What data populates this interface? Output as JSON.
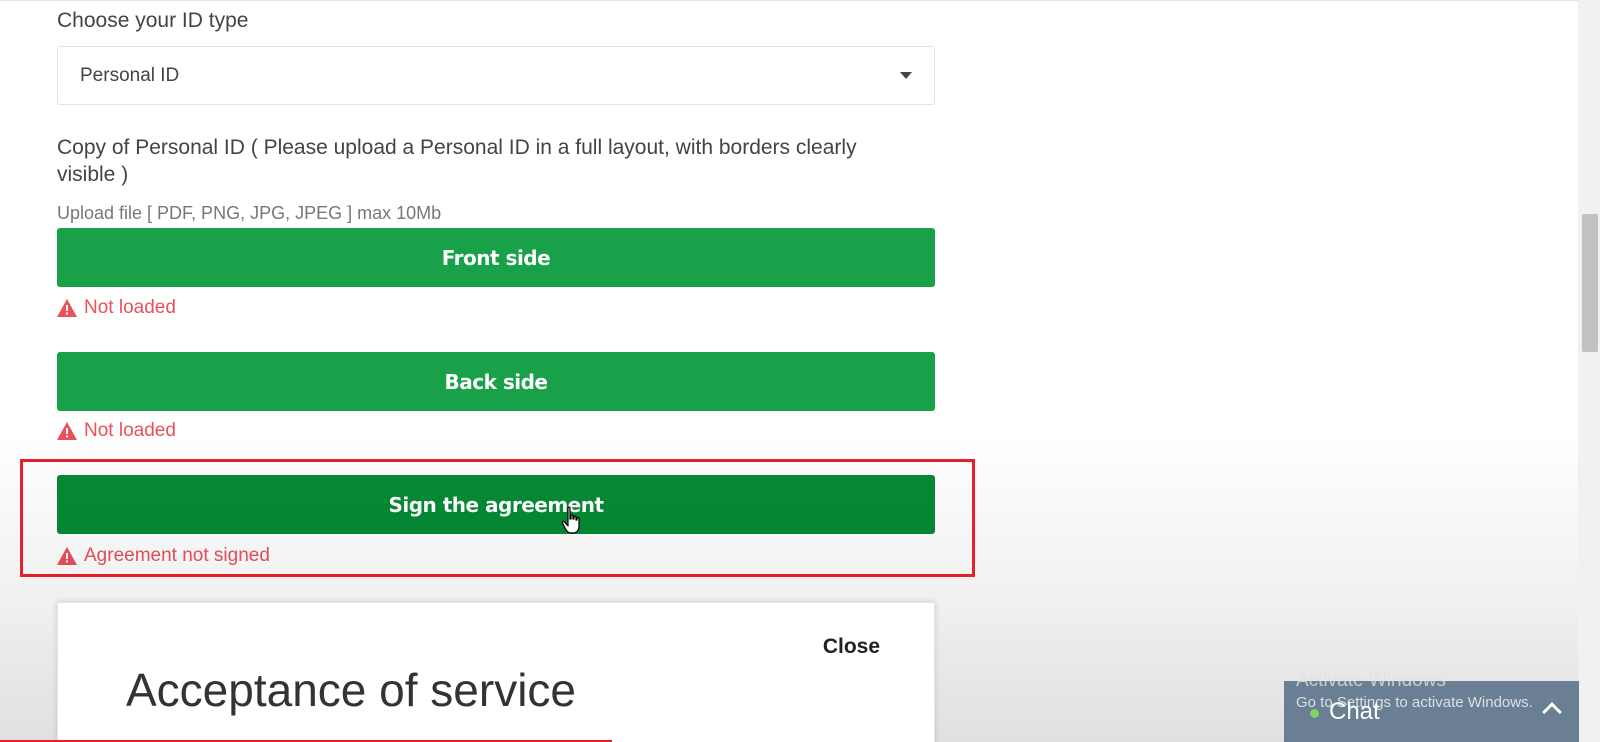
{
  "id_type": {
    "label": "Choose your ID type",
    "selected": "Personal ID"
  },
  "upload": {
    "copy_label": "Copy of Personal ID ( Please upload a Personal ID in a full layout, with borders clearly visible )",
    "hint": "Upload file [ PDF, PNG, JPG, JPEG ] max 10Mb",
    "front_label": "Front side",
    "front_status": "Not loaded",
    "back_label": "Back side",
    "back_status": "Not loaded"
  },
  "agreement": {
    "sign_label": "Sign the agreement",
    "status": "Agreement not signed"
  },
  "modal": {
    "close_label": "Close",
    "title": "Acceptance of service"
  },
  "chat": {
    "label": "Chat"
  },
  "watermark": {
    "line1": "Activate Windows",
    "line2": "Go to Settings to activate Windows."
  },
  "colors": {
    "button_green": "#18a148",
    "button_green_active": "#058a34",
    "error_red": "#e8515a",
    "highlight_red": "#e5202a",
    "chat_bg": "#6a7f93"
  }
}
